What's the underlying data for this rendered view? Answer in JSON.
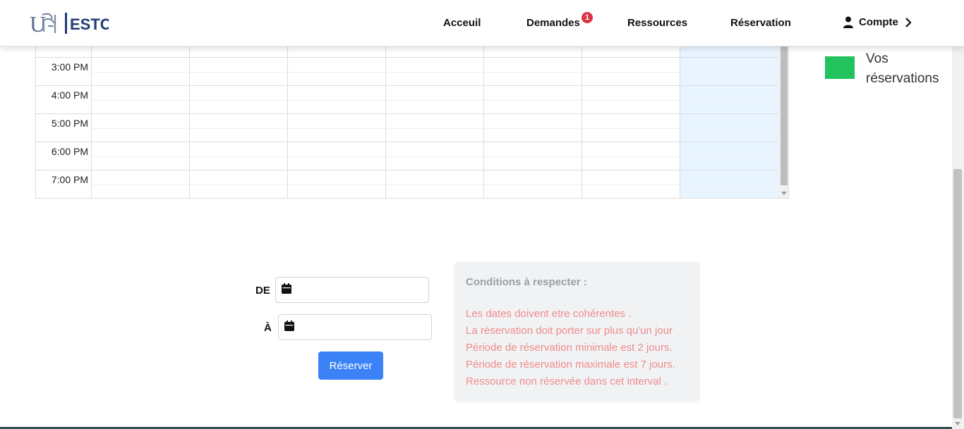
{
  "navbar": {
    "brand_text": "ESTC",
    "items": [
      {
        "label": "Acceuil"
      },
      {
        "label": "Demandes",
        "badge": "1"
      },
      {
        "label": "Ressources"
      },
      {
        "label": "Réservation"
      }
    ],
    "account_label": "Compte",
    "account_icon": "user-icon",
    "account_chevron": "chevron-right-icon"
  },
  "calendar": {
    "times": [
      "3:00 PM",
      "4:00 PM",
      "5:00 PM",
      "6:00 PM",
      "7:00 PM"
    ]
  },
  "legend": {
    "label": "Vos réservations",
    "color": "#22c35e"
  },
  "form": {
    "from_label": "DE",
    "to_label": "À",
    "from_value": "",
    "to_value": "",
    "submit_label": "Réserver",
    "accent_color": "#3b82f6"
  },
  "conditions": {
    "title": "Conditions à respecter :",
    "items": [
      "Les dates doivent etre cohérentes .",
      "La réservation doit porter sur plus qu'un jour",
      "Période de réservation minimale est 2 jours.",
      "Période de réservation maximale est 7 jours.",
      "Ressource non réservée dans cet interval ."
    ]
  }
}
